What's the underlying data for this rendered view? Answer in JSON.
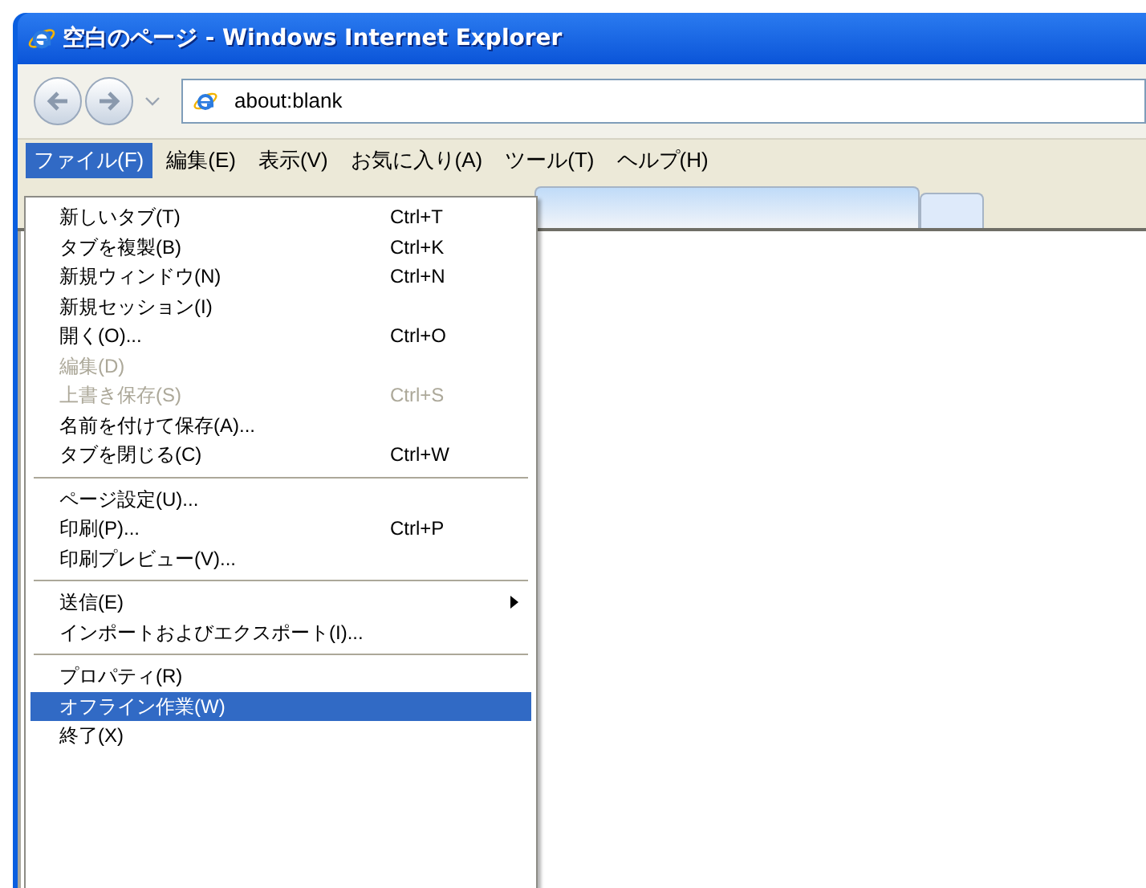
{
  "window": {
    "title": "空白のページ - Windows Internet Explorer"
  },
  "address_bar": {
    "value": "about:blank"
  },
  "menu_bar": [
    {
      "label": "ファイル(F)",
      "selected": true
    },
    {
      "label": "編集(E)",
      "selected": false
    },
    {
      "label": "表示(V)",
      "selected": false
    },
    {
      "label": "お気に入り(A)",
      "selected": false
    },
    {
      "label": "ツール(T)",
      "selected": false
    },
    {
      "label": "ヘルプ(H)",
      "selected": false
    }
  ],
  "file_menu": [
    {
      "kind": "item",
      "label": "新しいタブ(T)",
      "shortcut": "Ctrl+T",
      "disabled": false,
      "selected": false,
      "submenu": false
    },
    {
      "kind": "item",
      "label": "タブを複製(B)",
      "shortcut": "Ctrl+K",
      "disabled": false,
      "selected": false,
      "submenu": false
    },
    {
      "kind": "item",
      "label": "新規ウィンドウ(N)",
      "shortcut": "Ctrl+N",
      "disabled": false,
      "selected": false,
      "submenu": false
    },
    {
      "kind": "item",
      "label": "新規セッション(I)",
      "disabled": false,
      "selected": false,
      "submenu": false
    },
    {
      "kind": "item",
      "label": "開く(O)...",
      "shortcut": "Ctrl+O",
      "disabled": false,
      "selected": false,
      "submenu": false
    },
    {
      "kind": "item",
      "label": "編集(D)",
      "disabled": true,
      "selected": false,
      "submenu": false
    },
    {
      "kind": "item",
      "label": "上書き保存(S)",
      "shortcut": "Ctrl+S",
      "disabled": true,
      "selected": false,
      "submenu": false
    },
    {
      "kind": "item",
      "label": "名前を付けて保存(A)...",
      "disabled": false,
      "selected": false,
      "submenu": false
    },
    {
      "kind": "item",
      "label": "タブを閉じる(C)",
      "shortcut": "Ctrl+W",
      "disabled": false,
      "selected": false,
      "submenu": false
    },
    {
      "kind": "separator"
    },
    {
      "kind": "item",
      "label": "ページ設定(U)...",
      "disabled": false,
      "selected": false,
      "submenu": false
    },
    {
      "kind": "item",
      "label": "印刷(P)...",
      "shortcut": "Ctrl+P",
      "disabled": false,
      "selected": false,
      "submenu": false
    },
    {
      "kind": "item",
      "label": "印刷プレビュー(V)...",
      "disabled": false,
      "selected": false,
      "submenu": false
    },
    {
      "kind": "separator"
    },
    {
      "kind": "item",
      "label": "送信(E)",
      "disabled": false,
      "selected": false,
      "submenu": true
    },
    {
      "kind": "item",
      "label": "インポートおよびエクスポート(I)...",
      "disabled": false,
      "selected": false,
      "submenu": false
    },
    {
      "kind": "separator"
    },
    {
      "kind": "item",
      "label": "プロパティ(R)",
      "disabled": false,
      "selected": false,
      "submenu": false
    },
    {
      "kind": "item",
      "label": "オフライン作業(W)",
      "disabled": false,
      "selected": true,
      "submenu": false
    },
    {
      "kind": "item",
      "label": "終了(X)",
      "disabled": false,
      "selected": false,
      "submenu": false
    }
  ]
}
